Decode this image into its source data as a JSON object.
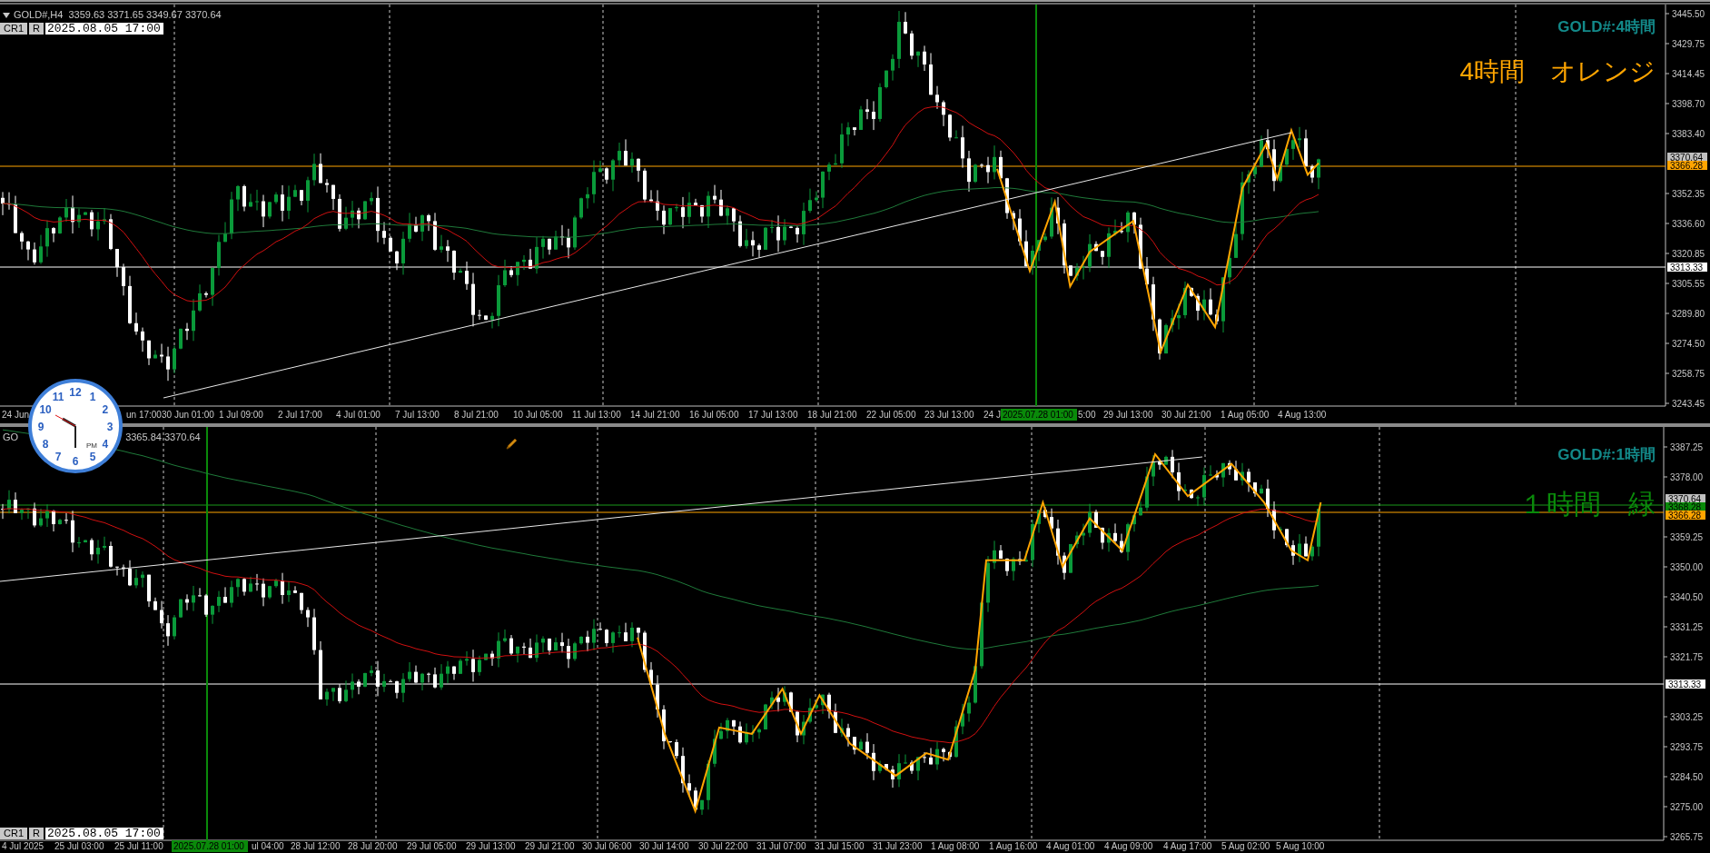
{
  "panes": [
    {
      "header": {
        "symbol": "GOLD#,H4",
        "prices": "3359.63 3371.65 3349.67 3370.64"
      },
      "controls": {
        "buttons": [
          "CR1",
          "R"
        ],
        "datetime": "2025.08.05 17:00"
      },
      "title": "GOLD#:4時間",
      "note": {
        "text": "4時間　オレンジ",
        "color": "#ffa500"
      },
      "price_axis": [
        "3445.50",
        "3429.75",
        "3414.45",
        "3398.70",
        "3383.40",
        "3352.35",
        "3336.60",
        "3320.85",
        "3305.55",
        "3289.80",
        "3274.50",
        "3258.75",
        "3243.45"
      ],
      "price_flags": [
        {
          "text": "3370.64",
          "color": "#c0c0c0"
        },
        {
          "text": "3366.28",
          "color": "#ffa500"
        },
        {
          "text": "3313.33",
          "color": "#ffffff"
        }
      ],
      "time_axis": [
        {
          "text": "24 Jun",
          "highlighted": false
        },
        {
          "text": "un 17:00",
          "highlighted": false
        },
        {
          "text": "30 Jun 01:00",
          "highlighted": false
        },
        {
          "text": "1 Jul 09:00",
          "highlighted": false
        },
        {
          "text": "2 Jul 17:00",
          "highlighted": false
        },
        {
          "text": "4 Jul 01:00",
          "highlighted": false
        },
        {
          "text": "7 Jul 13:00",
          "highlighted": false
        },
        {
          "text": "8 Jul 21:00",
          "highlighted": false
        },
        {
          "text": "10 Jul 05:00",
          "highlighted": false
        },
        {
          "text": "11 Jul 13:00",
          "highlighted": false
        },
        {
          "text": "14 Jul 21:00",
          "highlighted": false
        },
        {
          "text": "16 Jul 05:00",
          "highlighted": false
        },
        {
          "text": "17 Jul 13:00",
          "highlighted": false
        },
        {
          "text": "18 Jul 21:00",
          "highlighted": false
        },
        {
          "text": "22 Jul 05:00",
          "highlighted": false
        },
        {
          "text": "23 Jul 13:00",
          "highlighted": false
        },
        {
          "text": "24 J",
          "highlighted": false
        },
        {
          "text": "2025.07.28 01:00",
          "highlighted": true
        },
        {
          "text": "5:00",
          "highlighted": false
        },
        {
          "text": "29 Jul 13:00",
          "highlighted": false
        },
        {
          "text": "30 Jul 21:00",
          "highlighted": false
        },
        {
          "text": "1 Aug 05:00",
          "highlighted": false
        },
        {
          "text": "4 Aug 13:00",
          "highlighted": false
        }
      ]
    },
    {
      "header": {
        "symbol": "GO",
        "prices": "3365.84 3370.64"
      },
      "controls": {
        "buttons": [
          "CR1",
          "R"
        ],
        "datetime": "2025.08.05 17:00"
      },
      "title": "GOLD#:1時間",
      "note": {
        "text": "１時間　緑",
        "color": "#0a8a0a"
      },
      "price_axis": [
        "3387.25",
        "3378.00",
        "3359.25",
        "3350.00",
        "3340.50",
        "3331.25",
        "3321.75",
        "3303.25",
        "3293.75",
        "3284.50",
        "3275.00",
        "3265.75"
      ],
      "price_flags": [
        {
          "text": "3370.64",
          "color": "#c0c0c0"
        },
        {
          "text": "3368.28",
          "color": "#0a8a0a"
        },
        {
          "text": "3366.28",
          "color": "#ffa500"
        },
        {
          "text": "3313.33",
          "color": "#ffffff"
        }
      ],
      "time_axis": [
        {
          "text": "4 Jul 2025",
          "highlighted": false
        },
        {
          "text": "25 Jul 03:00",
          "highlighted": false
        },
        {
          "text": "25 Jul 11:00",
          "highlighted": false
        },
        {
          "text": "2025.07.28 01:00",
          "highlighted": true
        },
        {
          "text": "ul 04:00",
          "highlighted": false
        },
        {
          "text": "28 Jul 12:00",
          "highlighted": false
        },
        {
          "text": "28 Jul 20:00",
          "highlighted": false
        },
        {
          "text": "29 Jul 05:00",
          "highlighted": false
        },
        {
          "text": "29 Jul 13:00",
          "highlighted": false
        },
        {
          "text": "29 Jul 21:00",
          "highlighted": false
        },
        {
          "text": "30 Jul 06:00",
          "highlighted": false
        },
        {
          "text": "30 Jul 14:00",
          "highlighted": false
        },
        {
          "text": "30 Jul 22:00",
          "highlighted": false
        },
        {
          "text": "31 Jul 07:00",
          "highlighted": false
        },
        {
          "text": "31 Jul 15:00",
          "highlighted": false
        },
        {
          "text": "31 Jul 23:00",
          "highlighted": false
        },
        {
          "text": "1 Aug 08:00",
          "highlighted": false
        },
        {
          "text": "1 Aug 16:00",
          "highlighted": false
        },
        {
          "text": "4 Aug 01:00",
          "highlighted": false
        },
        {
          "text": "4 Aug 09:00",
          "highlighted": false
        },
        {
          "text": "4 Aug 17:00",
          "highlighted": false
        },
        {
          "text": "5 Aug 02:00",
          "highlighted": false
        },
        {
          "text": "5 Aug 10:00",
          "highlighted": false
        }
      ]
    }
  ],
  "clock": {
    "numbers": [
      "12",
      "11",
      "1",
      "10",
      "2",
      "9",
      "3",
      "8",
      "4",
      "7",
      "5",
      "6"
    ],
    "period": "PM"
  }
}
